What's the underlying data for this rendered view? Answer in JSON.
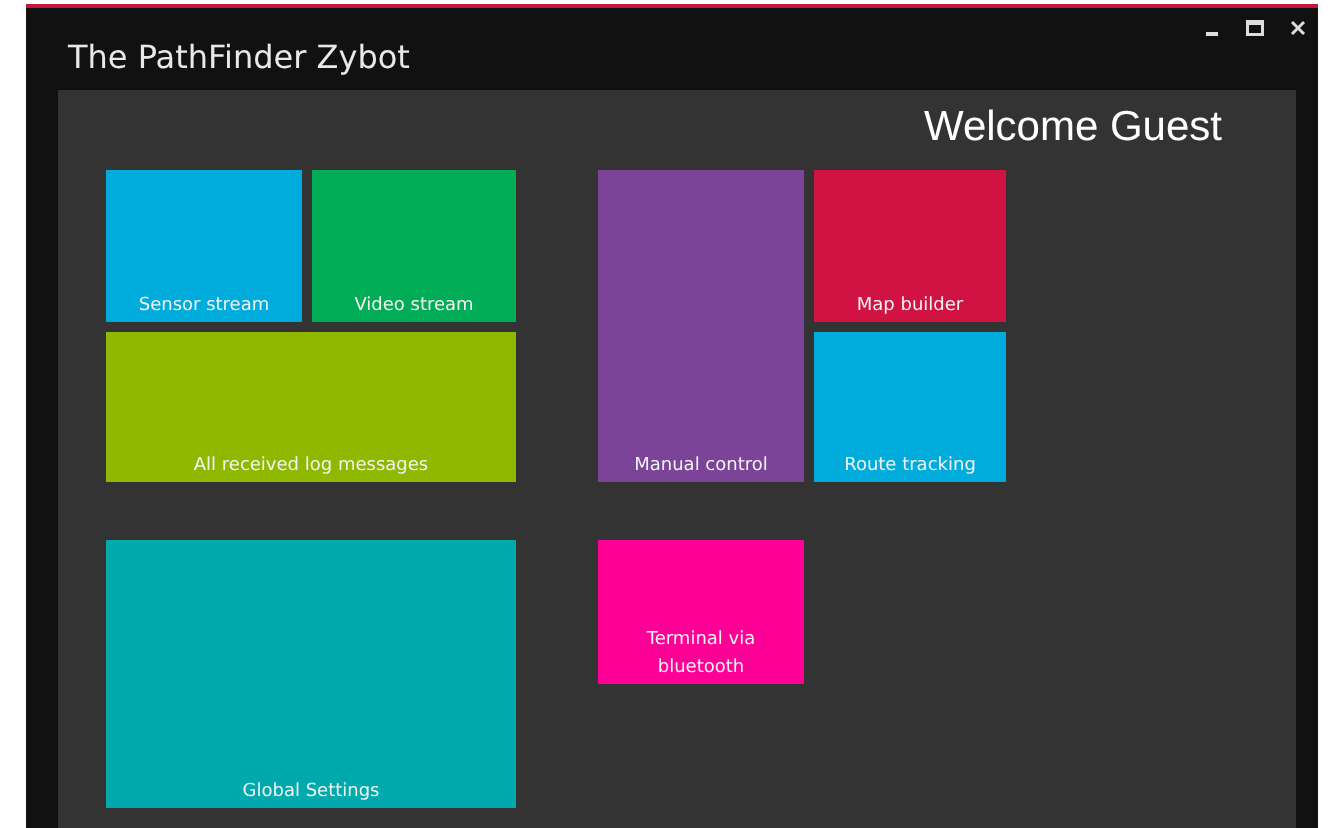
{
  "window": {
    "title": "The PathFinder Zybot"
  },
  "welcome": "Welcome Guest",
  "tiles": [
    {
      "label": "Sensor stream",
      "color": "#00acdb"
    },
    {
      "label": "Video stream",
      "color": "#00ad56"
    },
    {
      "label": "All received log messages",
      "color": "#8fb900"
    },
    {
      "label": "Manual control",
      "color": "#7c4498"
    },
    {
      "label": "Map builder",
      "color": "#d11343"
    },
    {
      "label": "Route tracking",
      "color": "#00acdb"
    },
    {
      "label": "Global Settings",
      "color": "#00a9ac"
    },
    {
      "label": "Terminal via bluetooth",
      "color": "#ff0097"
    }
  ]
}
